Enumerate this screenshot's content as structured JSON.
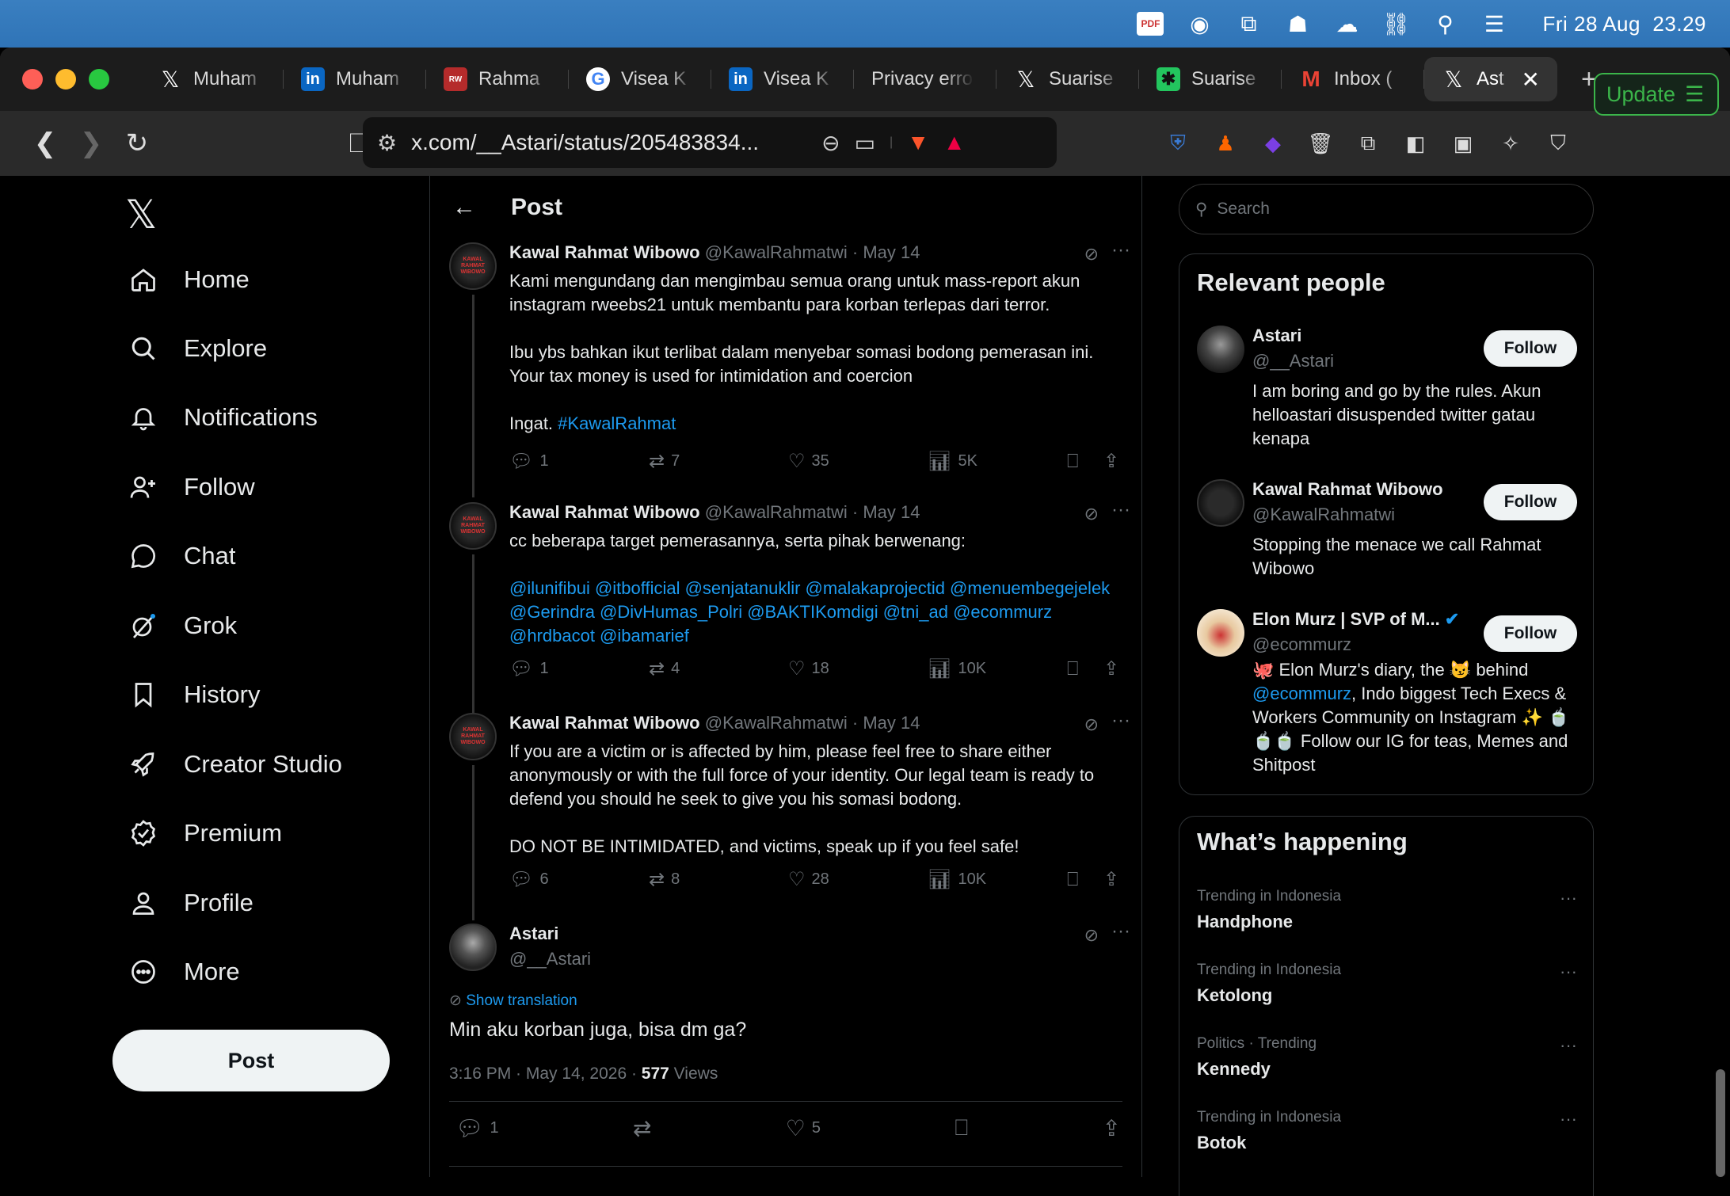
{
  "menubar": {
    "date": "Fri 28 Aug",
    "time": "23.29",
    "pdf_label": "PDF"
  },
  "tabs": [
    {
      "label": "Muham",
      "icon": "x-icon"
    },
    {
      "label": "Muham",
      "icon": "linkedin-icon"
    },
    {
      "label": "Rahma",
      "icon": "rw-icon"
    },
    {
      "label": "Visea K",
      "icon": "google-icon"
    },
    {
      "label": "Visea K",
      "icon": "linkedin-icon"
    },
    {
      "label": "Privacy erro",
      "icon": "none"
    },
    {
      "label": "Suarise",
      "icon": "x-icon"
    },
    {
      "label": "Suarise",
      "icon": "suarise-icon"
    },
    {
      "label": "Inbox (",
      "icon": "gmail-icon"
    },
    {
      "label": "Ast",
      "icon": "x-icon",
      "active": true
    }
  ],
  "toolbar": {
    "url": "x.com/__Astari/status/205483834...",
    "update_label": "Update"
  },
  "sidebar": {
    "items": [
      "Home",
      "Explore",
      "Notifications",
      "Follow",
      "Chat",
      "Grok",
      "History",
      "Creator Studio",
      "Premium",
      "Profile",
      "More"
    ],
    "post_label": "Post"
  },
  "main": {
    "title": "Post",
    "tweets": [
      {
        "name": "Kawal Rahmat Wibowo",
        "handle": "@KawalRahmatwi",
        "date": "· May 14",
        "avatar_text": "KAWAL RAHMAT WIBOWO",
        "body_1": "Kami mengundang dan mengimbau semua orang untuk mass-report akun instagram rweebs21 untuk membantu para korban terlepas dari terror.\n\nIbu ybs bahkan ikut terlibat dalam menyebar somasi bodong pemerasan ini. Your tax money is used for intimidation and coercion\n\nIngat. ",
        "hashtag": "#KawalRahmat",
        "replies": "1",
        "reposts": "7",
        "likes": "35",
        "views": "5K"
      },
      {
        "name": "Kawal Rahmat Wibowo",
        "handle": "@KawalRahmatwi",
        "date": "· May 14",
        "avatar_text": "KAWAL RAHMAT WIBOWO",
        "body_1": "cc beberapa target pemerasannya, serta pihak berwenang:\n\n",
        "mentions": "@ilunifibui @itbofficial @senjatanuklir @malakaprojectid @menuembegejelek @Gerindra @DivHumas_Polri @BAKTIKomdigi @tni_ad @ecommurz @hrdbacot @ibamarief",
        "replies": "1",
        "reposts": "4",
        "likes": "18",
        "views": "10K"
      },
      {
        "name": "Kawal Rahmat Wibowo",
        "handle": "@KawalRahmatwi",
        "date": "· May 14",
        "avatar_text": "KAWAL RAHMAT WIBOWO",
        "body_1": "If you are a victim or is affected by him, please feel free to share either anonymously or with the full force of your identity. Our legal team is ready to defend you should he seek to give you his somasi bodong.\n\nDO NOT BE INTIMIDATED, and victims, speak up if you feel safe!",
        "replies": "6",
        "reposts": "8",
        "likes": "28",
        "views": "10K"
      }
    ],
    "focus": {
      "name": "Astari",
      "handle": "@__Astari",
      "show_translation": "Show translation",
      "body": "Min aku korban juga, bisa dm ga?",
      "timestamp": "3:16 PM · May 14, 2026 · ",
      "views_count": "577",
      "views_label": " Views",
      "replies": "1",
      "likes": "5"
    }
  },
  "right": {
    "search_placeholder": "Search",
    "relevant_title": "Relevant people",
    "people": [
      {
        "name": "Astari",
        "handle": "@__Astari",
        "bio": "I am boring and go by the rules. Akun helloastari disuspended twitter gatau kenapa",
        "follow": "Follow"
      },
      {
        "name": "Kawal Rahmat Wibowo",
        "handle": "@KawalRahmatwi",
        "bio": "Stopping the menace we call Rahmat Wibowo",
        "follow": "Follow"
      },
      {
        "name": "Elon Murz | SVP of M...",
        "handle": "@ecommurz",
        "bio_1": "🐙 Elon Murz's diary, the 😼 behind ",
        "bio_link": "@ecommurz",
        "bio_2": ", Indo biggest Tech Execs & Workers Community on Instagram ✨ 🍵🍵🍵 Follow our IG for teas, Memes and Shitpost",
        "follow": "Follow"
      }
    ],
    "happening_title": "What’s happening",
    "trends": [
      {
        "context": "Trending in Indonesia",
        "name": "Handphone"
      },
      {
        "context": "Trending in Indonesia",
        "name": "Ketolong"
      },
      {
        "context": "Politics · Trending",
        "name": "Kennedy"
      },
      {
        "context": "Trending in Indonesia",
        "name": "Botok"
      }
    ]
  },
  "colors": {
    "accent": "#1d9bf0",
    "menubar": "#2f74b7",
    "update_green": "#3bb54a",
    "verified": "#1d9bf0"
  }
}
